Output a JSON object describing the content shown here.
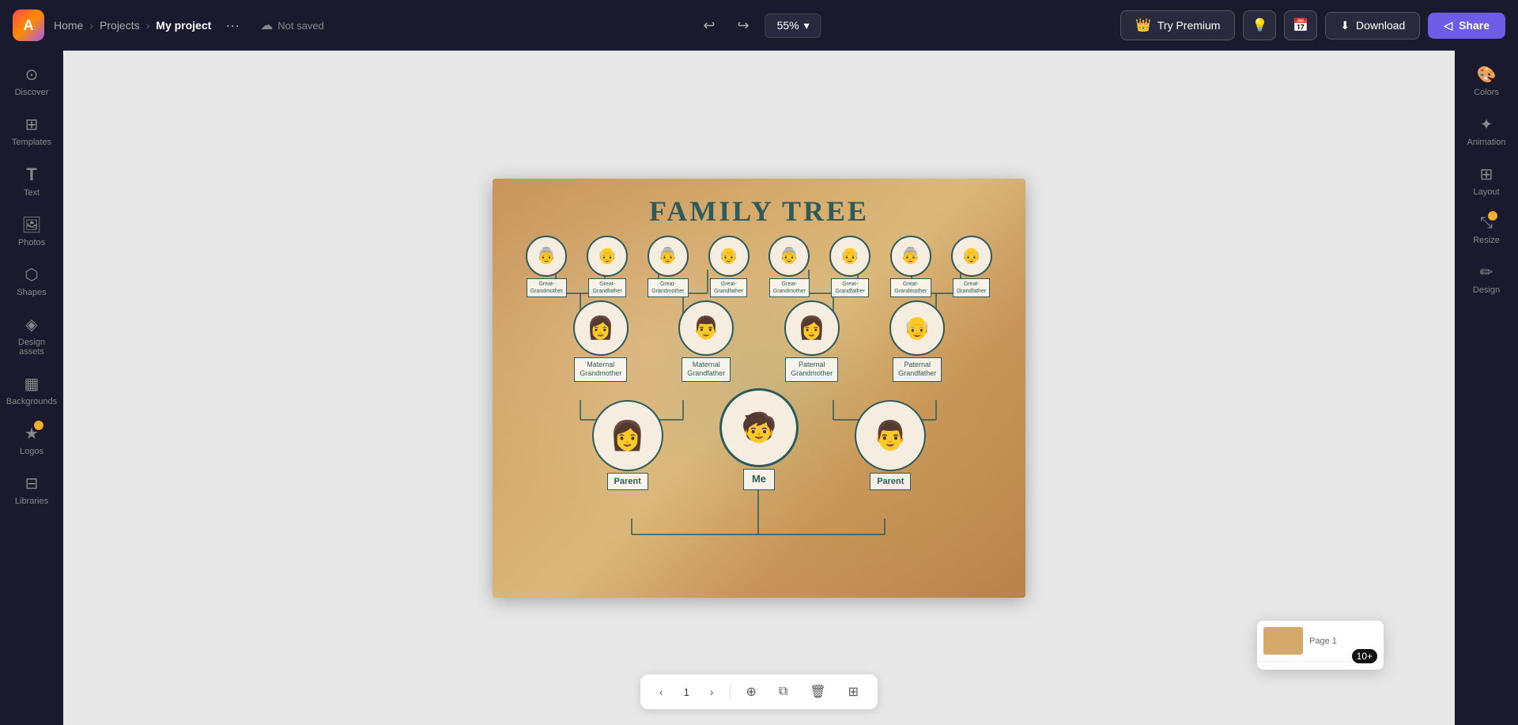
{
  "header": {
    "logo_text": "A",
    "nav": {
      "home": "Home",
      "projects": "Projects",
      "current": "My project"
    },
    "save_status": "Not saved",
    "zoom": "55%",
    "undo_label": "↩",
    "redo_label": "↪",
    "try_premium_label": "Try Premium",
    "download_label": "Download",
    "share_label": "Share"
  },
  "left_sidebar": {
    "items": [
      {
        "id": "discover",
        "icon": "⊙",
        "label": "Discover"
      },
      {
        "id": "templates",
        "icon": "⊞",
        "label": "Templates"
      },
      {
        "id": "text",
        "icon": "T",
        "label": "Text"
      },
      {
        "id": "photos",
        "icon": "🖼",
        "label": "Photos"
      },
      {
        "id": "shapes",
        "icon": "⬡",
        "label": "Shapes"
      },
      {
        "id": "design-assets",
        "icon": "◈",
        "label": "Design assets"
      },
      {
        "id": "backgrounds",
        "icon": "▦",
        "label": "Backgrounds"
      },
      {
        "id": "logos",
        "icon": "★",
        "label": "Logos"
      },
      {
        "id": "libraries",
        "icon": "⊟",
        "label": "Libraries"
      }
    ]
  },
  "canvas": {
    "title": "FAMILY TREE",
    "generation1": [
      {
        "id": "gg-maternal-1",
        "label": "Great-\nGrandmother",
        "emoji": "👵"
      },
      {
        "id": "gg-maternal-2",
        "label": "Great-\nGrandfather",
        "emoji": "👴"
      },
      {
        "id": "gg-maternal-3",
        "label": "Great-\nGrandmother",
        "emoji": "👵"
      },
      {
        "id": "gg-maternal-4",
        "label": "Great-\nGrandfather",
        "emoji": "👴"
      },
      {
        "id": "gg-paternal-1",
        "label": "Great-\nGrandmother",
        "emoji": "👵"
      },
      {
        "id": "gg-paternal-2",
        "label": "Great-\nGrandfather",
        "emoji": "👴"
      },
      {
        "id": "gg-paternal-3",
        "label": "Great-\nGrandmother",
        "emoji": "👵"
      },
      {
        "id": "gg-paternal-4",
        "label": "Great-\nGrandfather",
        "emoji": "👴"
      }
    ],
    "generation2": [
      {
        "id": "maternal-grandmother",
        "label": "Maternal\nGrandmother",
        "emoji": "👩"
      },
      {
        "id": "maternal-grandfather",
        "label": "Maternal\nGrandfather",
        "emoji": "👨"
      },
      {
        "id": "paternal-grandmother",
        "label": "Paternal\nGrandmother",
        "emoji": "👩"
      },
      {
        "id": "paternal-grandfather",
        "label": "Paternal\nGrandfather",
        "emoji": "👴"
      }
    ],
    "generation3": [
      {
        "id": "parent-left",
        "label": "Parent",
        "emoji": "👩"
      },
      {
        "id": "me",
        "label": "Me",
        "emoji": "🧒"
      },
      {
        "id": "parent-right",
        "label": "Parent",
        "emoji": "👨"
      }
    ]
  },
  "page_controls": {
    "page_number": "1",
    "prev_label": "‹",
    "next_label": "›"
  },
  "right_sidebar": {
    "items": [
      {
        "id": "colors",
        "icon": "🎨",
        "label": "Colors"
      },
      {
        "id": "animation",
        "icon": "✦",
        "label": "Animation"
      },
      {
        "id": "layout",
        "icon": "⊞",
        "label": "Layout"
      },
      {
        "id": "resize",
        "icon": "⤡",
        "label": "Resize"
      },
      {
        "id": "design",
        "icon": "✏",
        "label": "Design"
      }
    ]
  },
  "thumbnail_panel": {
    "count_label": "10+"
  }
}
